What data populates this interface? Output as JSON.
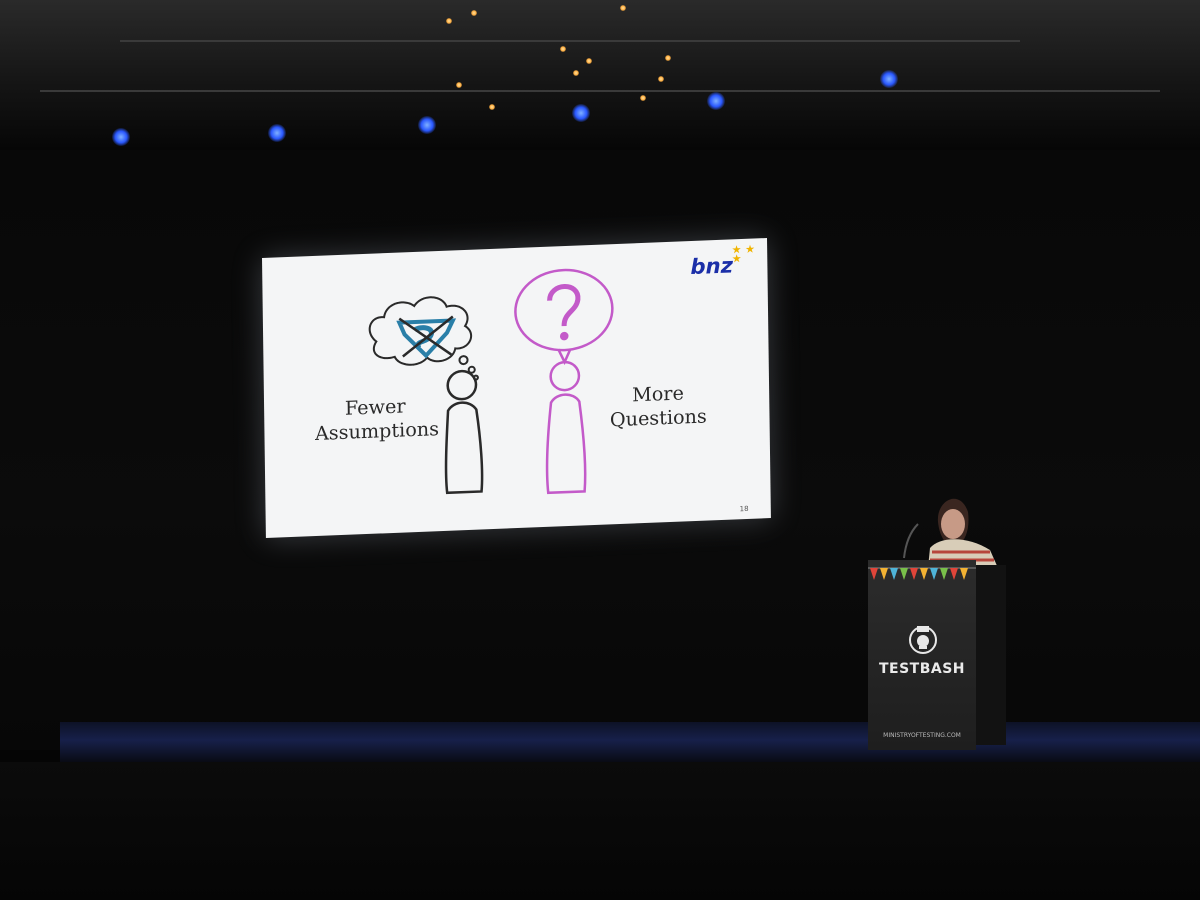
{
  "slide": {
    "logo_text": "bnz",
    "left_label": "Fewer\nAssumptions",
    "right_label": "More\nQuestions",
    "page_number": "18"
  },
  "podium": {
    "brand": "TESTBASH",
    "url": "MINISTRYOFTESTING.COM"
  },
  "colors": {
    "slide_background": "#f4f5f6",
    "logo_blue": "#1b2fa8",
    "question_purple": "#c35ac9",
    "crossed_logo_blue": "#2a7fa8",
    "stage_light_blue": "#2a58ff"
  },
  "icons": {
    "thought_bubble": "cloud-thought-icon",
    "speech_bubble": "question-speech-icon",
    "figure": "person-stick-icon"
  }
}
